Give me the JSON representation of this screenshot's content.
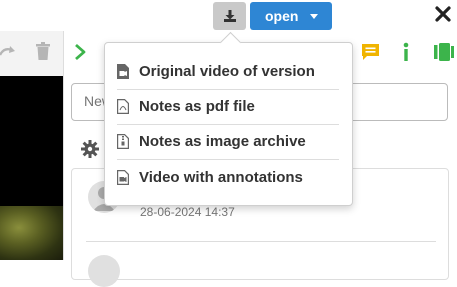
{
  "toolbar": {
    "open_label": "open",
    "download_icon": "download-icon",
    "close_icon": "close-x-icon"
  },
  "left_panel": {
    "icons": [
      "redo-icon",
      "trash-icon"
    ]
  },
  "right_panel": {
    "icons": [
      "play-icon",
      "comment-icon",
      "info-icon",
      "record-icon"
    ],
    "note_placeholder": "New note",
    "comment_date": "28-06-2024 14:37"
  },
  "download_menu": {
    "items": [
      {
        "label": "Original video of version",
        "icon": "file-video-icon"
      },
      {
        "label": "Notes as pdf file",
        "icon": "file-pdf-icon"
      },
      {
        "label": "Notes as image archive",
        "icon": "file-archive-icon"
      },
      {
        "label": "Video with annotations",
        "icon": "file-video-icon"
      }
    ]
  },
  "colors": {
    "accent": "#2e86d4",
    "green": "#3cb44b",
    "yellow": "#f0b400"
  }
}
